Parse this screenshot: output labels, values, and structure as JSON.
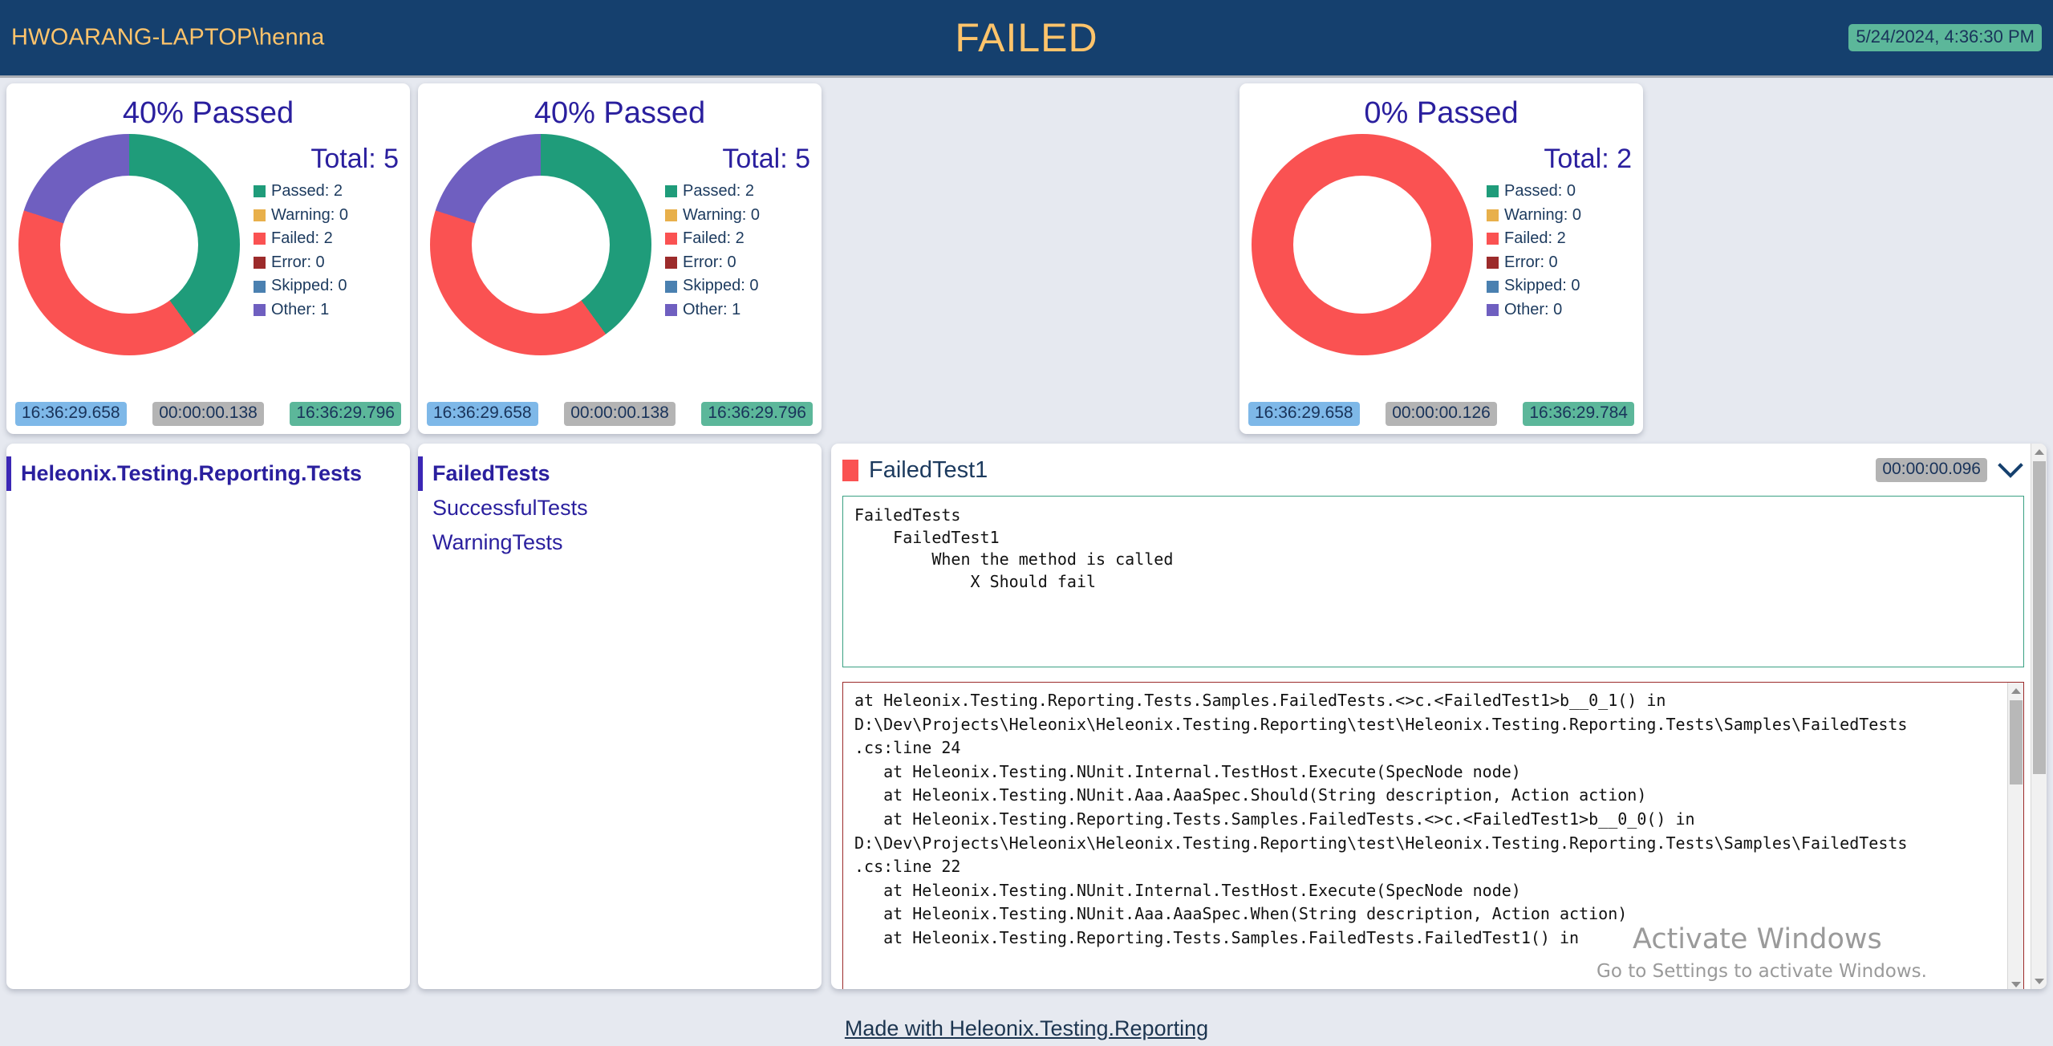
{
  "header": {
    "user": "HWOARANG-LAPTOP\\henna",
    "status": "FAILED",
    "timestamp": "5/24/2024, 4:36:30 PM"
  },
  "colors": {
    "header_bg": "#15406e",
    "header_text": "#ffc46b",
    "accent_purple": "#2a1f9e",
    "passed": "#1f9c7a",
    "warning": "#e8b04b",
    "failed": "#fa5252",
    "error": "#9c2b2b",
    "skipped": "#4a80b0",
    "other": "#6f5fc0",
    "badge_start": "#7eb8e8",
    "badge_duration": "#b4b4b4",
    "badge_end": "#5cb79a"
  },
  "summary_cards": [
    {
      "title": "40% Passed",
      "total_label": "Total: 5",
      "legend": [
        {
          "label": "Passed: 2",
          "color": "#1f9c7a"
        },
        {
          "label": "Warning: 0",
          "color": "#e8b04b"
        },
        {
          "label": "Failed: 2",
          "color": "#fa5252"
        },
        {
          "label": "Error: 0",
          "color": "#9c2b2b"
        },
        {
          "label": "Skipped: 0",
          "color": "#4a80b0"
        },
        {
          "label": "Other: 1",
          "color": "#6f5fc0"
        }
      ],
      "start_time": "16:36:29.658",
      "duration": "00:00:00.138",
      "end_time": "16:36:29.796"
    },
    {
      "title": "40% Passed",
      "total_label": "Total: 5",
      "legend": [
        {
          "label": "Passed: 2",
          "color": "#1f9c7a"
        },
        {
          "label": "Warning: 0",
          "color": "#e8b04b"
        },
        {
          "label": "Failed: 2",
          "color": "#fa5252"
        },
        {
          "label": "Error: 0",
          "color": "#9c2b2b"
        },
        {
          "label": "Skipped: 0",
          "color": "#4a80b0"
        },
        {
          "label": "Other: 1",
          "color": "#6f5fc0"
        }
      ],
      "start_time": "16:36:29.658",
      "duration": "00:00:00.138",
      "end_time": "16:36:29.796"
    },
    {
      "title": "0% Passed",
      "total_label": "Total: 2",
      "legend": [
        {
          "label": "Passed: 0",
          "color": "#1f9c7a"
        },
        {
          "label": "Warning: 0",
          "color": "#e8b04b"
        },
        {
          "label": "Failed: 2",
          "color": "#fa5252"
        },
        {
          "label": "Error: 0",
          "color": "#9c2b2b"
        },
        {
          "label": "Skipped: 0",
          "color": "#4a80b0"
        },
        {
          "label": "Other: 0",
          "color": "#6f5fc0"
        }
      ],
      "start_time": "16:36:29.658",
      "duration": "00:00:00.126",
      "end_time": "16:36:29.784"
    }
  ],
  "chart_data": [
    {
      "type": "pie",
      "title": "40% Passed",
      "categories": [
        "Passed",
        "Warning",
        "Failed",
        "Error",
        "Skipped",
        "Other"
      ],
      "values": [
        2,
        0,
        2,
        0,
        0,
        1
      ],
      "colors": [
        "#1f9c7a",
        "#e8b04b",
        "#fa5252",
        "#9c2b2b",
        "#4a80b0",
        "#6f5fc0"
      ],
      "total": 5,
      "legend_position": "right",
      "donut": true
    },
    {
      "type": "pie",
      "title": "40% Passed",
      "categories": [
        "Passed",
        "Warning",
        "Failed",
        "Error",
        "Skipped",
        "Other"
      ],
      "values": [
        2,
        0,
        2,
        0,
        0,
        1
      ],
      "colors": [
        "#1f9c7a",
        "#e8b04b",
        "#fa5252",
        "#9c2b2b",
        "#4a80b0",
        "#6f5fc0"
      ],
      "total": 5,
      "legend_position": "right",
      "donut": true
    },
    {
      "type": "pie",
      "title": "0% Passed",
      "categories": [
        "Passed",
        "Warning",
        "Failed",
        "Error",
        "Skipped",
        "Other"
      ],
      "values": [
        0,
        0,
        2,
        0,
        0,
        0
      ],
      "colors": [
        "#1f9c7a",
        "#e8b04b",
        "#fa5252",
        "#9c2b2b",
        "#4a80b0",
        "#6f5fc0"
      ],
      "total": 2,
      "legend_position": "right",
      "donut": true
    }
  ],
  "suites": {
    "items": [
      {
        "label": "Heleonix.Testing.Reporting.Tests",
        "active": true
      }
    ]
  },
  "tests": {
    "items": [
      {
        "label": "FailedTests",
        "active": true
      },
      {
        "label": "SuccessfulTests",
        "active": false
      },
      {
        "label": "WarningTests",
        "active": false
      }
    ]
  },
  "detail": {
    "name": "FailedTest1",
    "status_color": "#fa5252",
    "duration": "00:00:00.096",
    "chevron": "chevron-down-icon",
    "output": "FailedTests\n    FailedTest1\n        When the method is called\n            X Should fail",
    "stack_trace": "at Heleonix.Testing.Reporting.Tests.Samples.FailedTests.<>c.<FailedTest1>b__0_1() in\nD:\\Dev\\Projects\\Heleonix\\Heleonix.Testing.Reporting\\test\\Heleonix.Testing.Reporting.Tests\\Samples\\FailedTests\n.cs:line 24\n   at Heleonix.Testing.NUnit.Internal.TestHost.Execute(SpecNode node)\n   at Heleonix.Testing.NUnit.Aaa.AaaSpec.Should(String description, Action action)\n   at Heleonix.Testing.Reporting.Tests.Samples.FailedTests.<>c.<FailedTest1>b__0_0() in\nD:\\Dev\\Projects\\Heleonix\\Heleonix.Testing.Reporting\\test\\Heleonix.Testing.Reporting.Tests\\Samples\\FailedTests\n.cs:line 22\n   at Heleonix.Testing.NUnit.Internal.TestHost.Execute(SpecNode node)\n   at Heleonix.Testing.NUnit.Aaa.AaaSpec.When(String description, Action action)\n   at Heleonix.Testing.Reporting.Tests.Samples.FailedTests.FailedTest1() in"
  },
  "watermark": {
    "line1": "Activate Windows",
    "line2": "Go to Settings to activate Windows."
  },
  "footer": {
    "link_text": "Made with Heleonix.Testing.Reporting"
  }
}
